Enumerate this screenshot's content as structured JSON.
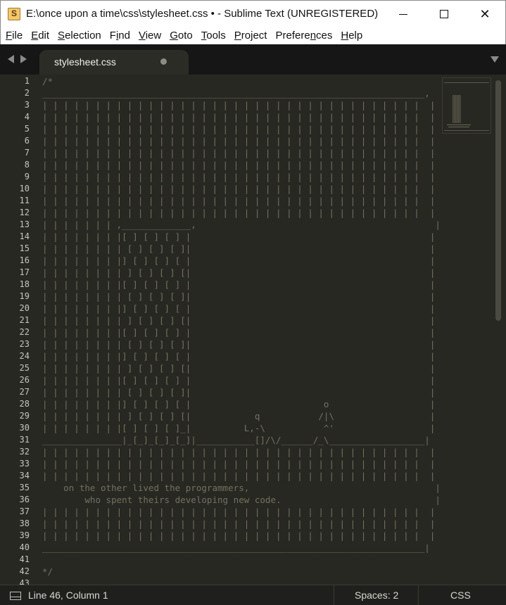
{
  "window": {
    "title": "E:\\once upon a time\\css\\stylesheet.css • - Sublime Text (UNREGISTERED)",
    "minimize_glyph": "",
    "close_glyph": "✕"
  },
  "menu": [
    {
      "pre": "",
      "u": "F",
      "post": "ile"
    },
    {
      "pre": "",
      "u": "E",
      "post": "dit"
    },
    {
      "pre": "",
      "u": "S",
      "post": "election"
    },
    {
      "pre": "F",
      "u": "i",
      "post": "nd"
    },
    {
      "pre": "",
      "u": "V",
      "post": "iew"
    },
    {
      "pre": "",
      "u": "G",
      "post": "oto"
    },
    {
      "pre": "",
      "u": "T",
      "post": "ools"
    },
    {
      "pre": "",
      "u": "P",
      "post": "roject"
    },
    {
      "pre": "Prefere",
      "u": "n",
      "post": "ces"
    },
    {
      "pre": "",
      "u": "H",
      "post": "elp"
    }
  ],
  "tab": {
    "label": "stylesheet.css",
    "modified": true
  },
  "editor": {
    "line_numbers": [
      "1",
      "2",
      "3",
      "4",
      "5",
      "6",
      "7",
      "8",
      "9",
      "10",
      "11",
      "12",
      "13",
      "14",
      "15",
      "16",
      "17",
      "18",
      "19",
      "20",
      "21",
      "22",
      "23",
      "24",
      "25",
      "26",
      "27",
      "28",
      "29",
      "30",
      "31",
      "32",
      "33",
      "34",
      "35",
      "36",
      "37",
      "38",
      "39",
      "40",
      "41",
      "42",
      "43"
    ],
    "lines": [
      "/*",
      "________________________________________________________________________,",
      "| | | | | | | | | | | | | | | | | | | | | | | | | | | | | | | | | | | |  |",
      "| | | | | | | | | | | | | | | | | | | | | | | | | | | | | | | | | | | |  |",
      "| | | | | | | | | | | | | | | | | | | | | | | | | | | | | | | | | | | |  |",
      "| | | | | | | | | | | | | | | | | | | | | | | | | | | | | | | | | | | |  |",
      "| | | | | | | | | | | | | | | | | | | | | | | | | | | | | | | | | | | |  |",
      "| | | | | | | | | | | | | | | | | | | | | | | | | | | | | | | | | | | |  |",
      "| | | | | | | | | | | | | | | | | | | | | | | | | | | | | | | | | | | |  |",
      "| | | | | | | | | | | | | | | | | | | | | | | | | | | | | | | | | | | |  |",
      "| | | | | | | | | | | | | | | | | | | | | | | | | | | | | | | | | | | |  |",
      "| | | | | | | | | | | | | | | | | | | | | | | | | | | | | | | | | | | |  |",
      "| | | | | | | ,_____________,                                             |",
      "| | | | | | | |[ ] [ ] [ ] |                                             |",
      "| | | | | | | | [ ] [ ] [ ]|                                             |",
      "| | | | | | | |] [ ] [ ] [ |                                             |",
      "| | | | | | | | ] [ ] [ ] [|                                             |",
      "| | | | | | | |[ ] [ ] [ ] |                                             |",
      "| | | | | | | | [ ] [ ] [ ]|                                             |",
      "| | | | | | | |] [ ] [ ] [ |                                             |",
      "| | | | | | | | ] [ ] [ ] [|                                             |",
      "| | | | | | | |[ ] [ ] [ ] |                                             |",
      "| | | | | | | | [ ] [ ] [ ]|                                             |",
      "| | | | | | | |] [ ] [ ] [ |                                             |",
      "| | | | | | | | ] [ ] [ ] [|                                             |",
      "| | | | | | | |[ ] [ ] [ ] |                                             |",
      "| | | | | | | | [ ] [ ] [ ]|                                             |",
      "| | | | | | | |] [ ] [ ] [ |                         o                   |",
      "| | | | | | | | ] [ ] [ ] [|            q           /|\\                  |",
      "| | | | | | | |[ ] [ ] [ ]_|          L,-\\           ^'                  |",
      "_______________|_[_]_[_]_[_]|___________[]/\\/______/_\\__________________|",
      "| | | | | | | | | | | | | | | | | | | | | | | | | | | | | | | | | | | |  |",
      "| | | | | | | | | | | | | | | | | | | | | | | | | | | | | | | | | | | |  |",
      "| | | | | | | | | | | | | | | | | | | | | | | | | | | | | | | | | | | |  |",
      "    on the other lived the programmers,                                   |",
      "        who spent theirs developing new code.                             |",
      "| | | | | | | | | | | | | | | | | | | | | | | | | | | | | | | | | | | |  |",
      "| | | | | | | | | | | | | | | | | | | | | | | | | | | | | | | | | | | |  |",
      "| | | | | | | | | | | | | | | | | | | | | | | | | | | | | | | | | | | |  |",
      "________________________________________________________________________|",
      "",
      "*/",
      ""
    ]
  },
  "status": {
    "position": "Line 46, Column 1",
    "spaces": "Spaces: 2",
    "syntax": "CSS"
  }
}
